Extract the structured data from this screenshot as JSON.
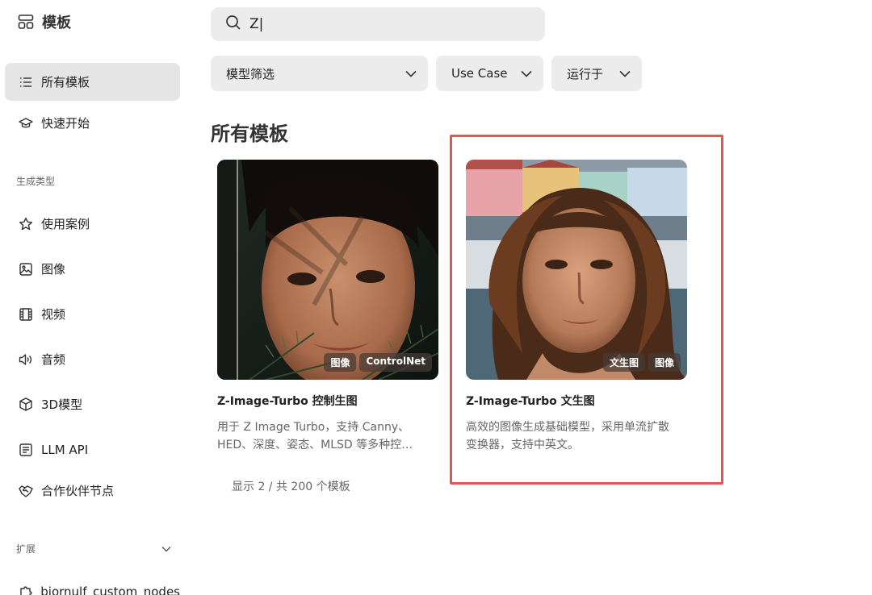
{
  "brand": {
    "title": "模板",
    "icon": "template-layout-icon"
  },
  "sidebar": {
    "items": [
      {
        "label": "所有模板",
        "icon": "list-icon",
        "active": true
      },
      {
        "label": "快速开始",
        "icon": "graduation-cap-icon"
      }
    ],
    "section_generate": "生成类型",
    "generate_items": [
      {
        "label": "使用案例",
        "icon": "star-icon"
      },
      {
        "label": "图像",
        "icon": "image-icon"
      },
      {
        "label": "视频",
        "icon": "film-icon"
      },
      {
        "label": "音频",
        "icon": "speaker-icon"
      },
      {
        "label": "3D模型",
        "icon": "cube-icon"
      },
      {
        "label": "LLM API",
        "icon": "document-icon"
      },
      {
        "label": "合作伙伴节点",
        "icon": "handshake-icon"
      }
    ],
    "section_extend": "扩展",
    "extend_items": [
      {
        "label": "bjornulf_custom_nodes",
        "icon": "puzzle-icon"
      }
    ]
  },
  "search": {
    "value": "Z|"
  },
  "filters": [
    {
      "label": "模型筛选"
    },
    {
      "label": "Use Case"
    },
    {
      "label": "运行于"
    }
  ],
  "main": {
    "title": "所有模板",
    "count_text": "显示 2 / 共 200 个模板"
  },
  "cards": [
    {
      "title": "Z-Image-Turbo 控制生图",
      "desc_line1": "用于 Z Image Turbo，支持 Canny、",
      "desc_line2": "HED、深度、姿态、MLSD 等多种控…",
      "tags": [
        "图像",
        "ControlNet"
      ]
    },
    {
      "title": "Z-Image-Turbo 文生图",
      "desc_line1": "高效的图像生成基础模型，采用单流扩散",
      "desc_line2": "变换器，支持中英文。",
      "tags": [
        "文生图",
        "图像"
      ]
    }
  ],
  "colors": {
    "highlight": "#e25555",
    "active_bg": "#e5e5e5",
    "control_bg": "#ececec"
  }
}
